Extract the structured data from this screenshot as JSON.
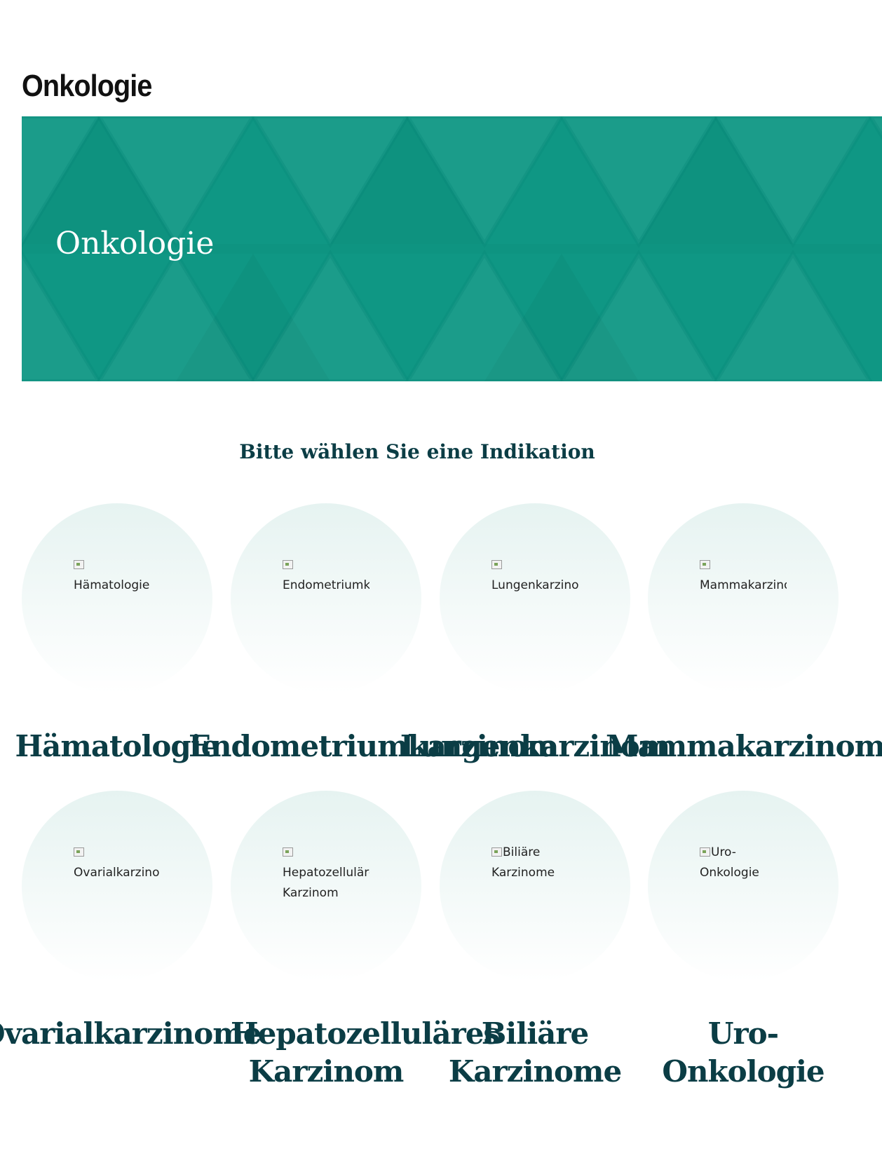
{
  "page_title": "Onkologie",
  "hero": {
    "title": "Onkologie"
  },
  "section_title": "Bitte wählen Sie eine Indikation",
  "indications": [
    {
      "alt": "Hämatologie",
      "label": "Hämatologie"
    },
    {
      "alt": "Endometriumkarzinom",
      "label": "Endometriumkarzinom"
    },
    {
      "alt": "Lungenkarzinom",
      "label": "Lungenkarzinom"
    },
    {
      "alt": "Mammakarzinom",
      "label": "Mammakarzinom"
    },
    {
      "alt": "Ovarialkarzinom",
      "label": "Ovarialkarzinome"
    },
    {
      "alt": "Hepatozelluläre Karzinom",
      "label": "Hepatozelluläres Karzinom"
    },
    {
      "alt": "Biliäre Karzinome",
      "label": "Biliäre Karzinome"
    },
    {
      "alt": "Uro-Onkologie",
      "label": "Uro-Onkologie"
    }
  ],
  "colors": {
    "hero_bg": "#0f9784",
    "heading_color": "#0b3d45"
  }
}
